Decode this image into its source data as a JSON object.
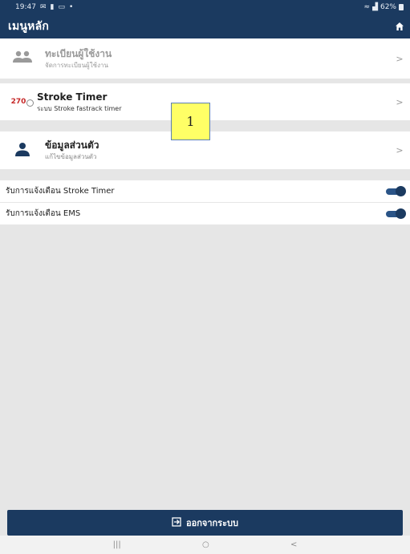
{
  "status_bar": {
    "time": "19:47",
    "left_icons": [
      "mail-icon",
      "person-icon",
      "image-icon",
      "dot-icon"
    ],
    "battery": "62%"
  },
  "app_bar": {
    "title": "เมนูหลัก",
    "home_icon": "home-icon"
  },
  "menu": {
    "register": {
      "label": "ทะเบียนผู้ใช้งาน",
      "sub": "จัดการทะเบียนผู้ใช้งาน",
      "icon": "people-icon",
      "chevron": ">"
    },
    "stroke": {
      "label": "Stroke Timer",
      "sub": "ระบบ Stroke fastrack timer",
      "logo_text": "270",
      "chevron": ">"
    },
    "profile": {
      "label": "ข้อมูลส่วนตัว",
      "sub": "แก้ไขข้อมูลส่วนตัว",
      "icon": "person-icon",
      "chevron": ">"
    }
  },
  "toggles": [
    {
      "label": "รับการแจ้งเตือน Stroke Timer",
      "on": true
    },
    {
      "label": "รับการแจ้งเตือน EMS",
      "on": true
    }
  ],
  "callout": {
    "text": "1"
  },
  "logout": {
    "label": "ออกจากระบบ",
    "icon": "logout-icon"
  },
  "nav": {
    "recent": "|||",
    "home": "○",
    "back": "<"
  },
  "colors": {
    "primary": "#1b3a60",
    "background": "#e6e6e6",
    "callout": "#ffff66",
    "logo_red": "#c62828"
  }
}
